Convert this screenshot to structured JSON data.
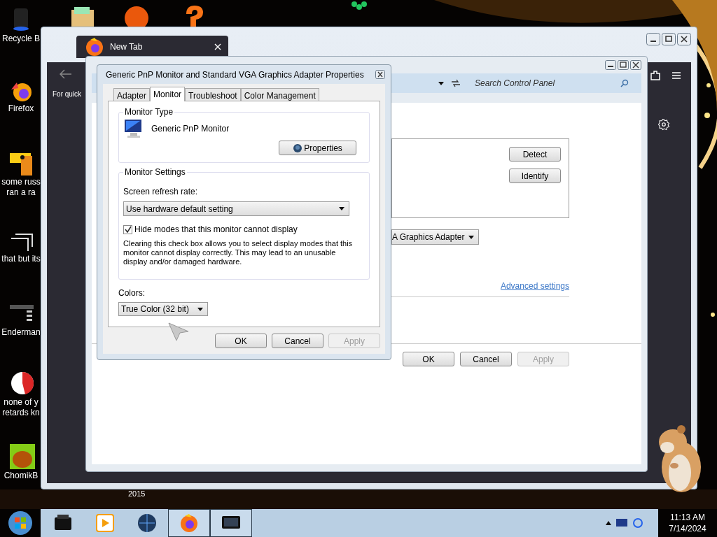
{
  "desktop": {
    "icons": [
      {
        "kind": "bin",
        "lines": [
          "Recycle B"
        ]
      },
      {
        "kind": "firefox",
        "lines": [
          "Firefox"
        ]
      },
      {
        "kind": "doc",
        "lines": [
          "some russ",
          "ran a ra"
        ]
      },
      {
        "kind": "windows",
        "lines": [
          "that but its"
        ]
      },
      {
        "kind": "terminal",
        "lines": [
          "Enderman"
        ]
      },
      {
        "kind": "chrome",
        "lines": [
          "none of y",
          "retards kn"
        ]
      },
      {
        "kind": "hamster",
        "lines": [
          "ChomikB"
        ]
      }
    ],
    "caption": "2015"
  },
  "browser": {
    "tab": {
      "title": "New Tab"
    },
    "toolbar_text": "For quick"
  },
  "control_panel": {
    "search": {
      "placeholder": "Search Control Panel"
    },
    "side_buttons": [
      "Detect",
      "Identify"
    ],
    "adapter_dropdown": "A Graphics Adapter",
    "link": "Advanced settings",
    "buttons": [
      {
        "label": "OK",
        "disabled": false
      },
      {
        "label": "Cancel",
        "disabled": false
      },
      {
        "label": "Apply",
        "disabled": true
      }
    ]
  },
  "dialog": {
    "title": "Generic PnP Monitor and Standard VGA Graphics Adapter Properties",
    "tabs": [
      {
        "label": "Adapter",
        "selected": false
      },
      {
        "label": "Monitor",
        "selected": true
      },
      {
        "label": "Troubleshoot",
        "selected": false
      },
      {
        "label": "Color Management",
        "selected": false
      }
    ],
    "monitor_type": {
      "legend": "Monitor Type",
      "name": "Generic PnP Monitor",
      "button": "Properties"
    },
    "monitor_settings": {
      "legend": "Monitor Settings",
      "refresh_label": "Screen refresh rate:",
      "refresh_value": "Use hardware default setting",
      "hide_modes": {
        "label": "Hide modes that this monitor cannot display",
        "checked": true
      },
      "note": "Clearing this check box allows you to select display modes that this monitor cannot display correctly. This may lead to an unusable display and/or damaged hardware."
    },
    "colors": {
      "label": "Colors:",
      "value": "True Color (32 bit)"
    },
    "buttons": [
      {
        "label": "OK",
        "disabled": false
      },
      {
        "label": "Cancel",
        "disabled": false
      },
      {
        "label": "Apply",
        "disabled": true
      }
    ]
  },
  "taskbar": {
    "apps": [
      {
        "kind": "printer",
        "selected": false
      },
      {
        "kind": "media",
        "selected": false
      },
      {
        "kind": "globe",
        "selected": false
      },
      {
        "kind": "firefox",
        "selected": true
      },
      {
        "kind": "display",
        "selected": true
      }
    ],
    "clock": {
      "time": "11:13 AM",
      "date": "7/14/2024"
    }
  }
}
